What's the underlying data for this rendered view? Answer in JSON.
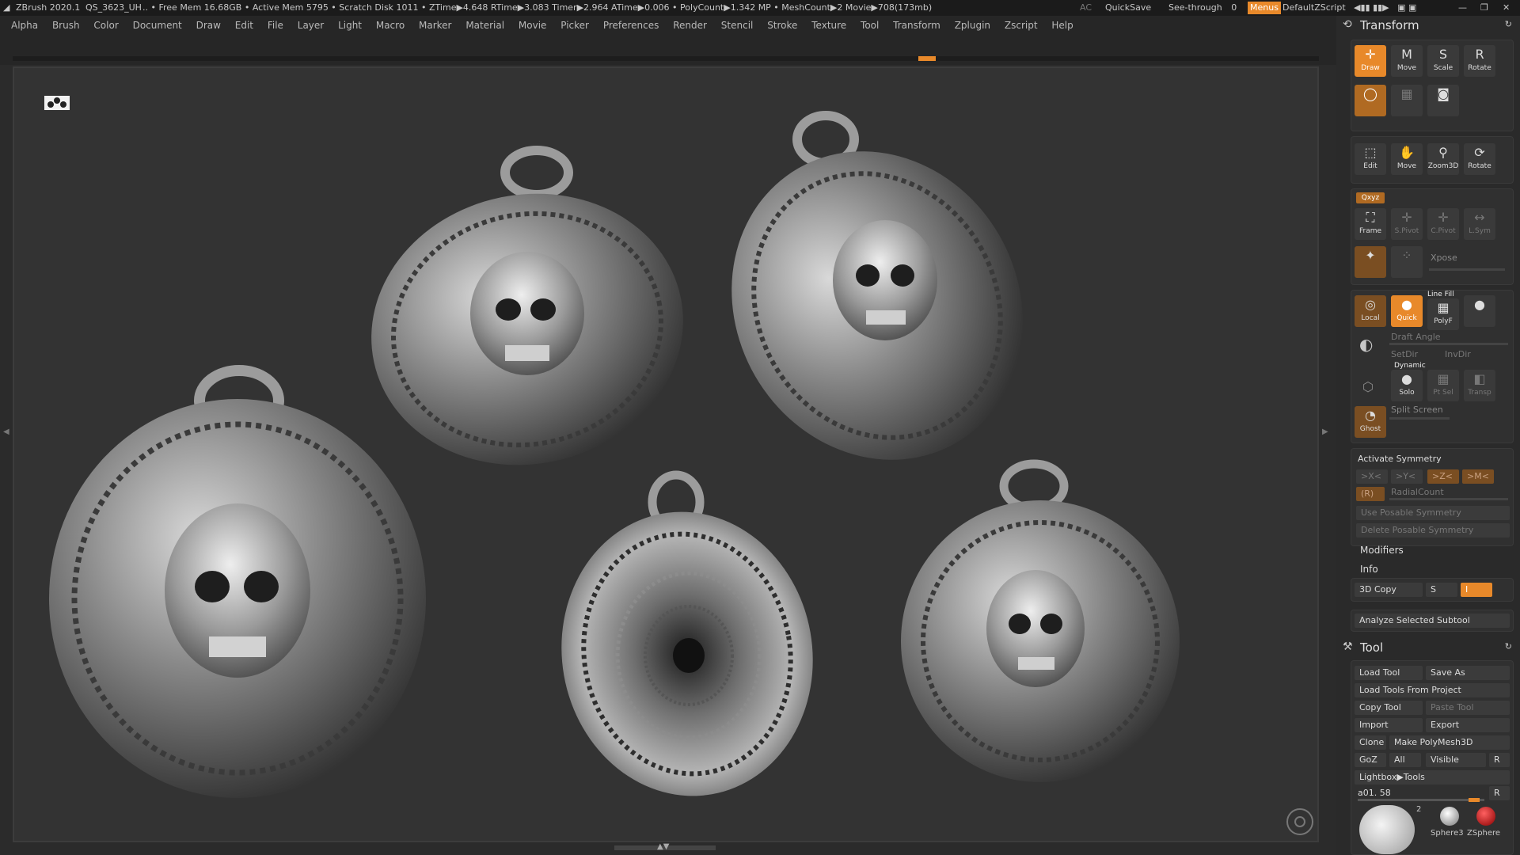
{
  "titlebar": {
    "app": "ZBrush 2020.1",
    "project": "QS_3623_UH",
    "stats": ".. • Free Mem 16.68GB • Active Mem 5795 • Scratch Disk 1011 • ZTime▶4.648 RTime▶3.083 Timer▶2.964 ATime▶0.006 • PolyCount▶1.342 MP • MeshCount▶2 Movie▶708(173mb)",
    "ac": "AC",
    "quicksave": "QuickSave",
    "seethrough": "See-through",
    "seethrough_value": "0",
    "menus": "Menus",
    "zscript": "DefaultZScript"
  },
  "menu": [
    "Alpha",
    "Brush",
    "Color",
    "Document",
    "Draw",
    "Edit",
    "File",
    "Layer",
    "Light",
    "Macro",
    "Marker",
    "Material",
    "Movie",
    "Picker",
    "Preferences",
    "Render",
    "Stencil",
    "Stroke",
    "Texture",
    "Tool",
    "Transform",
    "Zplugin",
    "Zscript",
    "Help"
  ],
  "transform": {
    "title": "Transform",
    "row1": [
      "Draw",
      "Move",
      "Scale",
      "Rotate"
    ],
    "row2": [
      "Edit",
      "Move",
      "Zoom3D",
      "Rotate"
    ],
    "xyz": "Qxyz",
    "row3": [
      "Frame",
      "S.Pivot",
      "C.Pivot",
      "L.Sym"
    ],
    "xpose": "Xpose",
    "row4": [
      "Local",
      "Quick",
      "PolyF"
    ],
    "linefill": "Line Fill",
    "draft": "Draft Angle",
    "setdir": "SetDir",
    "invdir": "InvDir",
    "dynamic": "Dynamic",
    "row5": [
      "Solo",
      "Pt Sel",
      "Transp"
    ],
    "split": "Split Screen",
    "ghost": "Ghost",
    "activate_sym": "Activate Symmetry",
    "sym_buttons": [
      ">X<",
      ">Y<",
      ">Z<",
      ">M<"
    ],
    "radial": "RadialCount",
    "r_label": "(R)",
    "posable": "Use Posable Symmetry",
    "del_posable": "Delete Posable Symmetry",
    "modifiers": "Modifiers",
    "info": "Info",
    "copy3d": "3D Copy",
    "s_label": "S",
    "analyze": "Analyze Selected Subtool"
  },
  "tool": {
    "title": "Tool",
    "load": "Load Tool",
    "saveas": "Save As",
    "loadproj": "Load Tools From Project",
    "copy": "Copy Tool",
    "paste": "Paste Tool",
    "import": "Import",
    "export": "Export",
    "clone": "Clone",
    "makepoly": "Make PolyMesh3D",
    "goz": "GoZ",
    "all": "All",
    "visible": "Visible",
    "r": "R",
    "lightbox": "Lightbox▶Tools",
    "current": "a01. 58",
    "count": "2",
    "sphere3": "Sphere3",
    "zsphere": "ZSphere"
  },
  "colors": {
    "accent": "#e8892a",
    "panel": "#2a2a2a",
    "canvas": "#333333"
  }
}
